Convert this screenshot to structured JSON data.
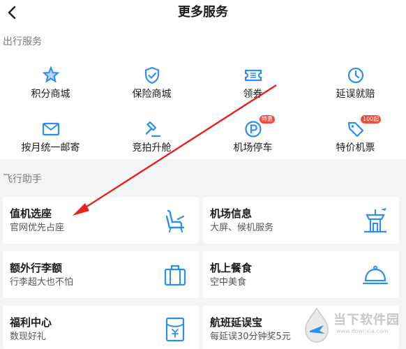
{
  "header": {
    "title": "更多服务",
    "back_icon": "back-arrow-icon"
  },
  "travel_services": {
    "title": "出行服务",
    "items": [
      {
        "label": "积分商城",
        "icon": "points-star-icon"
      },
      {
        "label": "保险商城",
        "icon": "shield-check-icon"
      },
      {
        "label": "领券",
        "icon": "coupon-ticket-icon"
      },
      {
        "label": "延误就赔",
        "icon": "clock-icon"
      },
      {
        "label": "按月统一邮寄",
        "icon": "mail-envelope-icon"
      },
      {
        "label": "竞拍升舱",
        "icon": "auction-hammer-icon"
      },
      {
        "label": "机场停车",
        "icon": "parking-p-icon",
        "badge": "特惠"
      },
      {
        "label": "特价机票",
        "icon": "price-tag-icon",
        "badge": "100起"
      }
    ]
  },
  "flight_assistant": {
    "title": "飞行助手",
    "cards": [
      {
        "title": "值机选座",
        "subtitle": "官网优先占座",
        "icon": "seat-icon"
      },
      {
        "title": "机场信息",
        "subtitle": "大屏、候机服务",
        "icon": "airport-tower-icon"
      },
      {
        "title": "额外行李额",
        "subtitle": "行李超大也不怕",
        "icon": "luggage-icon"
      },
      {
        "title": "机上餐食",
        "subtitle": "空中美食",
        "icon": "meal-cloche-icon"
      },
      {
        "title": "福利中心",
        "subtitle": "数现好礼",
        "icon": "red-envelope-icon"
      },
      {
        "title": "航班延误宝",
        "subtitle": "每延误30分钟奖5元",
        "icon": "plane-icon"
      }
    ]
  },
  "watermark": {
    "name": "当下软件园",
    "url": "www.downxia.com"
  },
  "colors": {
    "accent": "#2b8ef0",
    "badge": "#f04a3a",
    "arrow": "#e8201e"
  }
}
